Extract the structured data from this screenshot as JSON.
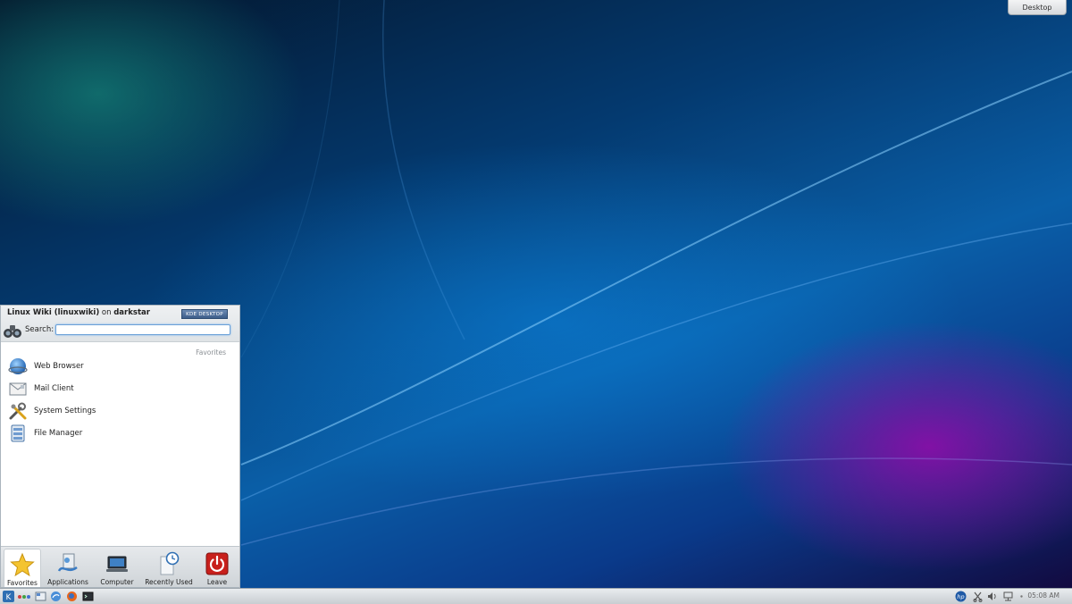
{
  "desktop": {
    "toolbox_label": "Desktop"
  },
  "launcher": {
    "user_name": "Linux Wiki (linuxwiki)",
    "on_text": "on",
    "host_name": "darkstar",
    "kde_badge": "KDE DESKTOP",
    "search_label": "Search:",
    "search_value": "",
    "section_label": "Favorites",
    "favorites": [
      {
        "label": "Web Browser",
        "icon": "web-browser-icon"
      },
      {
        "label": "Mail Client",
        "icon": "mail-client-icon"
      },
      {
        "label": "System Settings",
        "icon": "system-settings-icon"
      },
      {
        "label": "File Manager",
        "icon": "file-manager-icon"
      }
    ],
    "tabs": [
      {
        "label": "Favorites",
        "icon": "star-icon",
        "active": true
      },
      {
        "label": "Applications",
        "icon": "applications-icon",
        "active": false
      },
      {
        "label": "Computer",
        "icon": "computer-icon",
        "active": false
      },
      {
        "label": "Recently Used",
        "icon": "recently-used-icon",
        "active": false
      },
      {
        "label": "Leave",
        "icon": "power-icon",
        "active": false
      }
    ]
  },
  "panel": {
    "clock": "05:08 AM"
  },
  "colors": {
    "accent": "#3d6fb0",
    "leave_red": "#c8201c"
  }
}
